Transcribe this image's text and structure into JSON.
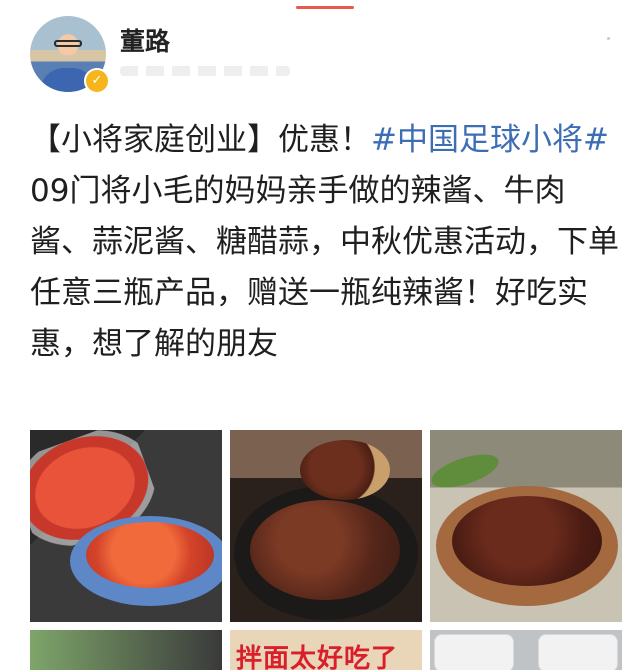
{
  "header": {
    "username": "董路",
    "verified_badge": "✓"
  },
  "post": {
    "segments": [
      {
        "text": "【小将家庭创业】优惠！",
        "type": "text"
      },
      {
        "text": "#中国足球小将#",
        "type": "hashtag"
      },
      {
        "text": " 09门将小毛的妈妈亲手做的辣酱、牛肉酱、蒜泥酱、糖醋蒜，中秋优惠活动，下单任意三瓶产品，赠送一瓶纯辣酱！好吃实惠，想了解的朋友",
        "type": "text"
      }
    ],
    "hashtag_color": "#3d6db5"
  },
  "photos": [
    {
      "name": "chili-sauce-jar-photo"
    },
    {
      "name": "beef-sauce-bowl-photo"
    },
    {
      "name": "sauce-dish-photo"
    },
    {
      "name": "photo-4"
    },
    {
      "name": "photo-5",
      "banner_text": "拌面太好吃了"
    },
    {
      "name": "photo-6"
    }
  ],
  "colors": {
    "accent": "#e8594b",
    "badge": "#f5b51b"
  }
}
